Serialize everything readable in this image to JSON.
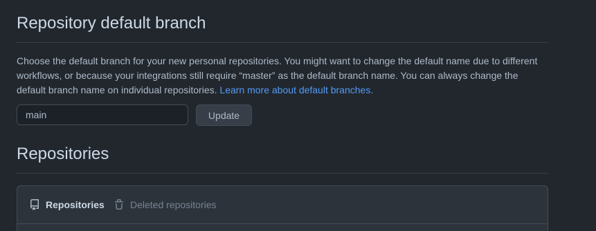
{
  "branch_section": {
    "title": "Repository default branch",
    "description": "Choose the default branch for your new personal repositories. You might want to change the default name due to different workflows, or because your integrations still require “master” as the default branch name. You can always change the default branch name on individual repositories.",
    "learn_more_link": "Learn more about default branches.",
    "branch_input_value": "main",
    "update_button": "Update"
  },
  "repositories_section": {
    "title": "Repositories",
    "tabs": [
      {
        "label": "Repositories",
        "icon": "repo-icon",
        "active": true
      },
      {
        "label": "Deleted repositories",
        "icon": "trash-icon",
        "active": false
      }
    ]
  },
  "colors": {
    "background": "#22272e",
    "heading": "#cdd9e5",
    "text": "#adbac7",
    "link": "#539bf5",
    "border": "#444c56",
    "muted": "#768390"
  }
}
